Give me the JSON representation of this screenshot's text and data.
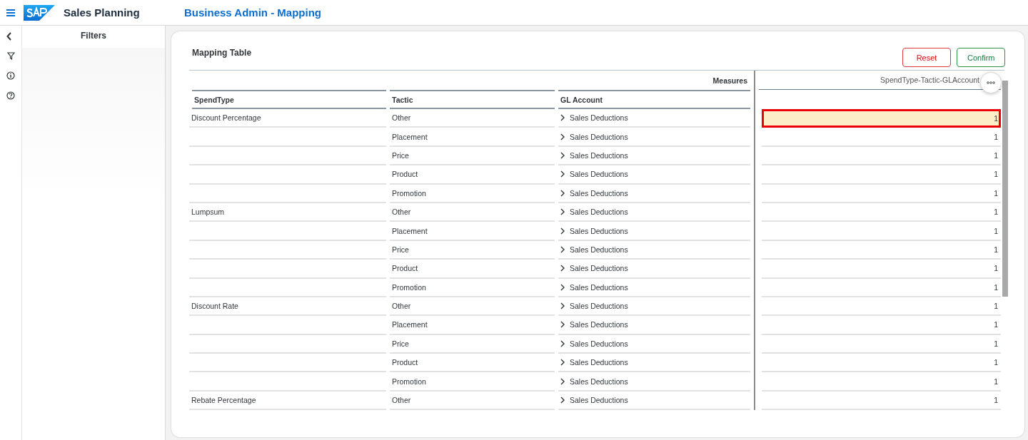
{
  "app": {
    "title": "Sales Planning",
    "page_title": "Business Admin - Mapping"
  },
  "filters": {
    "title": "Filters"
  },
  "card": {
    "title": "Mapping Table",
    "buttons": [
      {
        "label": "Reset",
        "kind": "reset"
      },
      {
        "label": "Confirm",
        "kind": "confirm"
      }
    ]
  },
  "table": {
    "group_header": "Measures",
    "columns": [
      "SpendType",
      "Tactic",
      "GL Account",
      "SpendType-Tactic-GLAccount"
    ],
    "rows": [
      {
        "spend_type": "Discount Percentage",
        "tactic": "Other",
        "gl_account": "Sales Deductions",
        "value": "1",
        "selected": true
      },
      {
        "tactic": "Placement",
        "gl_account": "Sales Deductions",
        "value": "1",
        "selected": false
      },
      {
        "tactic": "Price",
        "gl_account": "Sales Deductions",
        "value": "1",
        "selected": false
      },
      {
        "tactic": "Product",
        "gl_account": "Sales Deductions",
        "value": "1",
        "selected": false
      },
      {
        "tactic": "Promotion",
        "gl_account": "Sales Deductions",
        "value": "1",
        "selected": false
      },
      {
        "spend_type": "Lumpsum",
        "tactic": "Other",
        "gl_account": "Sales Deductions",
        "value": "1",
        "selected": false
      },
      {
        "tactic": "Placement",
        "gl_account": "Sales Deductions",
        "value": "1",
        "selected": false
      },
      {
        "tactic": "Price",
        "gl_account": "Sales Deductions",
        "value": "1",
        "selected": false
      },
      {
        "tactic": "Product",
        "gl_account": "Sales Deductions",
        "value": "1",
        "selected": false
      },
      {
        "tactic": "Promotion",
        "gl_account": "Sales Deductions",
        "value": "1",
        "selected": false
      },
      {
        "spend_type": "Discount Rate",
        "tactic": "Other",
        "gl_account": "Sales Deductions",
        "value": "1",
        "selected": false
      },
      {
        "tactic": "Placement",
        "gl_account": "Sales Deductions",
        "value": "1",
        "selected": false
      },
      {
        "tactic": "Price",
        "gl_account": "Sales Deductions",
        "value": "1",
        "selected": false
      },
      {
        "tactic": "Product",
        "gl_account": "Sales Deductions",
        "value": "1",
        "selected": false
      },
      {
        "tactic": "Promotion",
        "gl_account": "Sales Deductions",
        "value": "1",
        "selected": false
      },
      {
        "spend_type": "Rebate Percentage",
        "tactic": "Other",
        "gl_account": "Sales Deductions",
        "value": "1",
        "selected": false
      }
    ]
  }
}
